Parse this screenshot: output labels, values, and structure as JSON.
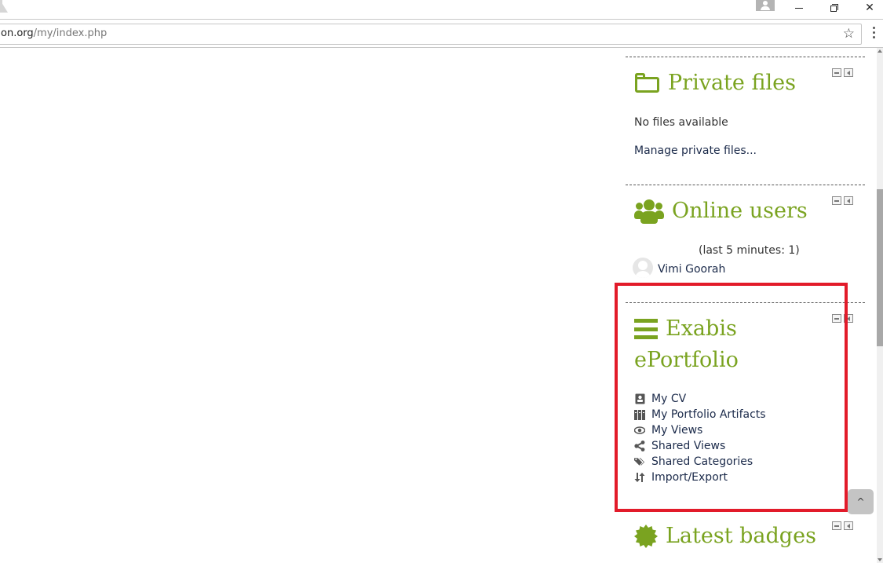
{
  "browser": {
    "url_domain": "on.org",
    "url_path": "/my/index.php",
    "bookmark_icon": "star-icon",
    "menu_icon": "vertical-dots-icon",
    "window_controls": [
      "minimize",
      "maximize",
      "close"
    ]
  },
  "blocks": {
    "private_files": {
      "title": "Private files",
      "icon": "folder-icon",
      "empty_text": "No files available",
      "manage_link": "Manage private files..."
    },
    "online_users": {
      "title": "Online users",
      "icon": "users-icon",
      "summary": "(last 5 minutes: 1)",
      "users": [
        {
          "name": "Vimi Goorah",
          "avatar": "default-avatar-icon"
        }
      ]
    },
    "exabis": {
      "title_line1": "Exabis",
      "title_line2": "ePortfolio",
      "icon": "bars-icon",
      "items": [
        {
          "label": "My CV",
          "icon": "id-card-icon"
        },
        {
          "label": "My Portfolio Artifacts",
          "icon": "archive-icon"
        },
        {
          "label": "My Views",
          "icon": "eye-icon"
        },
        {
          "label": "Shared Views",
          "icon": "share-icon"
        },
        {
          "label": "Shared Categories",
          "icon": "tags-icon"
        },
        {
          "label": "Import/Export",
          "icon": "sort-arrows-icon"
        }
      ]
    },
    "latest_badges": {
      "title": "Latest badges",
      "icon": "badge-icon"
    }
  },
  "colors": {
    "accent": "#7aa320",
    "highlight": "#e21b2a",
    "link": "#1b2a4a"
  },
  "back_to_top": "^"
}
